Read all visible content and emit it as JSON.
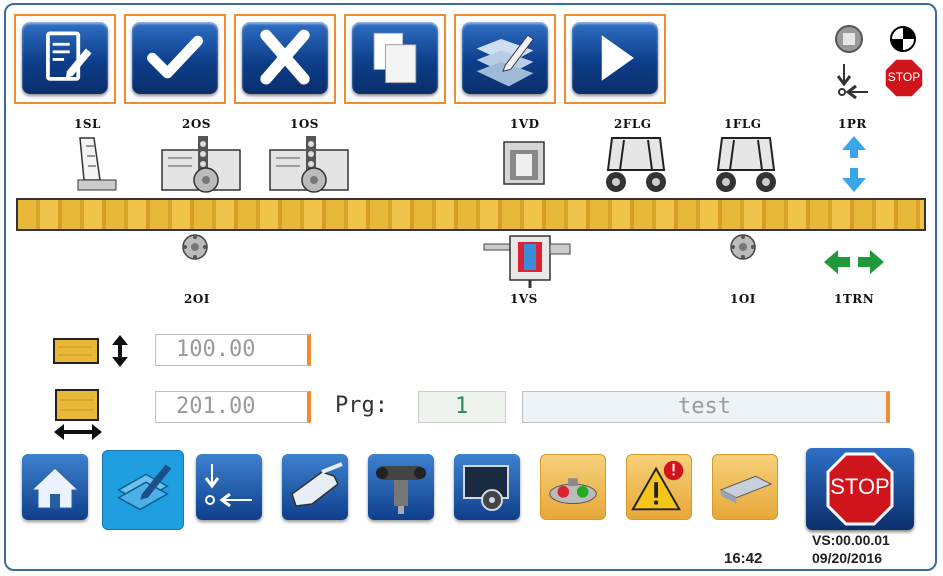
{
  "stations_top": [
    {
      "id": "sl",
      "label": "1SL"
    },
    {
      "id": "os2",
      "label": "2OS"
    },
    {
      "id": "os1",
      "label": "1OS"
    },
    {
      "id": "vd",
      "label": "1VD"
    },
    {
      "id": "flg2",
      "label": "2FLG"
    },
    {
      "id": "flg1",
      "label": "1FLG"
    },
    {
      "id": "pr",
      "label": "1PR"
    }
  ],
  "stations_bottom": [
    {
      "id": "oi2",
      "label": "2OI"
    },
    {
      "id": "vs",
      "label": "1VS"
    },
    {
      "id": "oi1",
      "label": "1OI"
    },
    {
      "id": "trn",
      "label": "1TRN"
    }
  ],
  "toolbar": {
    "edit_icon": "edit-document-icon",
    "confirm_icon": "checkmark-icon",
    "cancel_icon": "x-icon",
    "copy_icon": "copy-icon",
    "draw_icon": "draw-map-icon",
    "run_icon": "play-icon"
  },
  "panel": {
    "height_value": "100.00",
    "width_value": "201.00",
    "prg_label": "Prg:",
    "prg_value": "1",
    "program_name": "test"
  },
  "stop_sign_text": "STOP",
  "stop_button_text": "STOP",
  "status": {
    "time": "16:42",
    "version": "VS:00.00.01",
    "date": "09/20/2016"
  },
  "colors": {
    "toolbar_blue": "#0d3e8a",
    "accent_orange": "#f28a2e",
    "nav_active": "#1f9ee0",
    "stop_red": "#d0141c",
    "beam_wood": "#e8b838",
    "arrow_green": "#1e9a3a",
    "arrow_blue": "#3aa6e8"
  }
}
